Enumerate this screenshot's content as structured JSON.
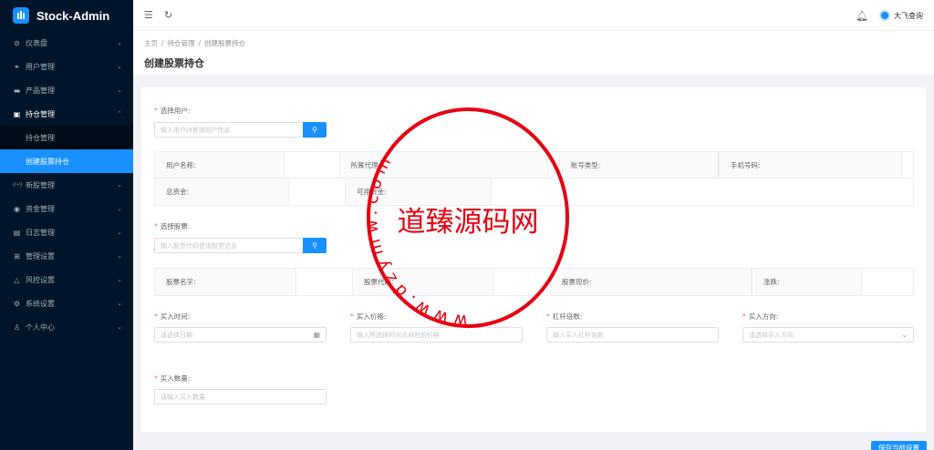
{
  "app": {
    "brand": "Stock-Admin"
  },
  "sidebar": {
    "items": [
      {
        "label": "仪表盘",
        "icon": "dashboard-icon",
        "glyph": "⊘"
      },
      {
        "label": "用户管理",
        "icon": "users-icon",
        "glyph": "⚭"
      },
      {
        "label": "产品管理",
        "icon": "product-icon",
        "glyph": "▬"
      },
      {
        "label": "持仓管理",
        "icon": "position-icon",
        "glyph": "▣",
        "open": true,
        "children": [
          {
            "label": "持仓管理",
            "active": false
          },
          {
            "label": "创建股票持仓",
            "active": true
          }
        ]
      },
      {
        "label": "新股管理",
        "icon": "ipo-icon",
        "glyph": "((•))"
      },
      {
        "label": "资金管理",
        "icon": "fund-icon",
        "glyph": "◉"
      },
      {
        "label": "日志管理",
        "icon": "log-icon",
        "glyph": "▤"
      },
      {
        "label": "管理设置",
        "icon": "admin-settings-icon",
        "glyph": "⊞"
      },
      {
        "label": "风控设置",
        "icon": "risk-icon",
        "glyph": "△"
      },
      {
        "label": "系统设置",
        "icon": "system-icon",
        "glyph": "⚙"
      },
      {
        "label": "个人中心",
        "icon": "person-icon",
        "glyph": "♙"
      }
    ]
  },
  "header": {
    "user_name": "大飞查询"
  },
  "breadcrumb": [
    "主页",
    "持仓管理",
    "创建股票持仓"
  ],
  "page_title": "创建股票持仓",
  "form": {
    "user_label": "选择用户:",
    "user_placeholder": "输入用户id查询用户信息",
    "user_table": [
      [
        "用户名称:",
        "",
        "所属代理:",
        "",
        "账号类型:",
        "",
        "手机号码:",
        ""
      ],
      [
        "总资金:",
        "",
        "可用资金:",
        ""
      ]
    ],
    "stock_label": "选择股票:",
    "stock_placeholder": "输入股票代码查询股票信息",
    "stock_table": [
      "股票名字:",
      "",
      "股票代码:",
      "",
      "股票现价:",
      "",
      "涨跌:",
      ""
    ],
    "buy_time_label": "买入时间:",
    "buy_time_placeholder": "请选择日期",
    "buy_price_label": "买入价格:",
    "buy_price_placeholder": "输入所选择时间点对应的价格",
    "leverage_label": "杠杆倍数:",
    "leverage_placeholder": "输入买入杠杆倍数",
    "direction_label": "买入方向:",
    "direction_placeholder": "请选择买入方向",
    "qty_label": "买入数量:",
    "qty_placeholder": "请输入买入数量",
    "save_label": "保存当前设置"
  },
  "watermark": {
    "center_text": "道臻源码网",
    "ring_text": "www.dzymw.com",
    "color": "#e60012"
  },
  "colors": {
    "accent": "#1890ff",
    "sidebar_bg": "#001529",
    "required": "#f56c6c"
  }
}
